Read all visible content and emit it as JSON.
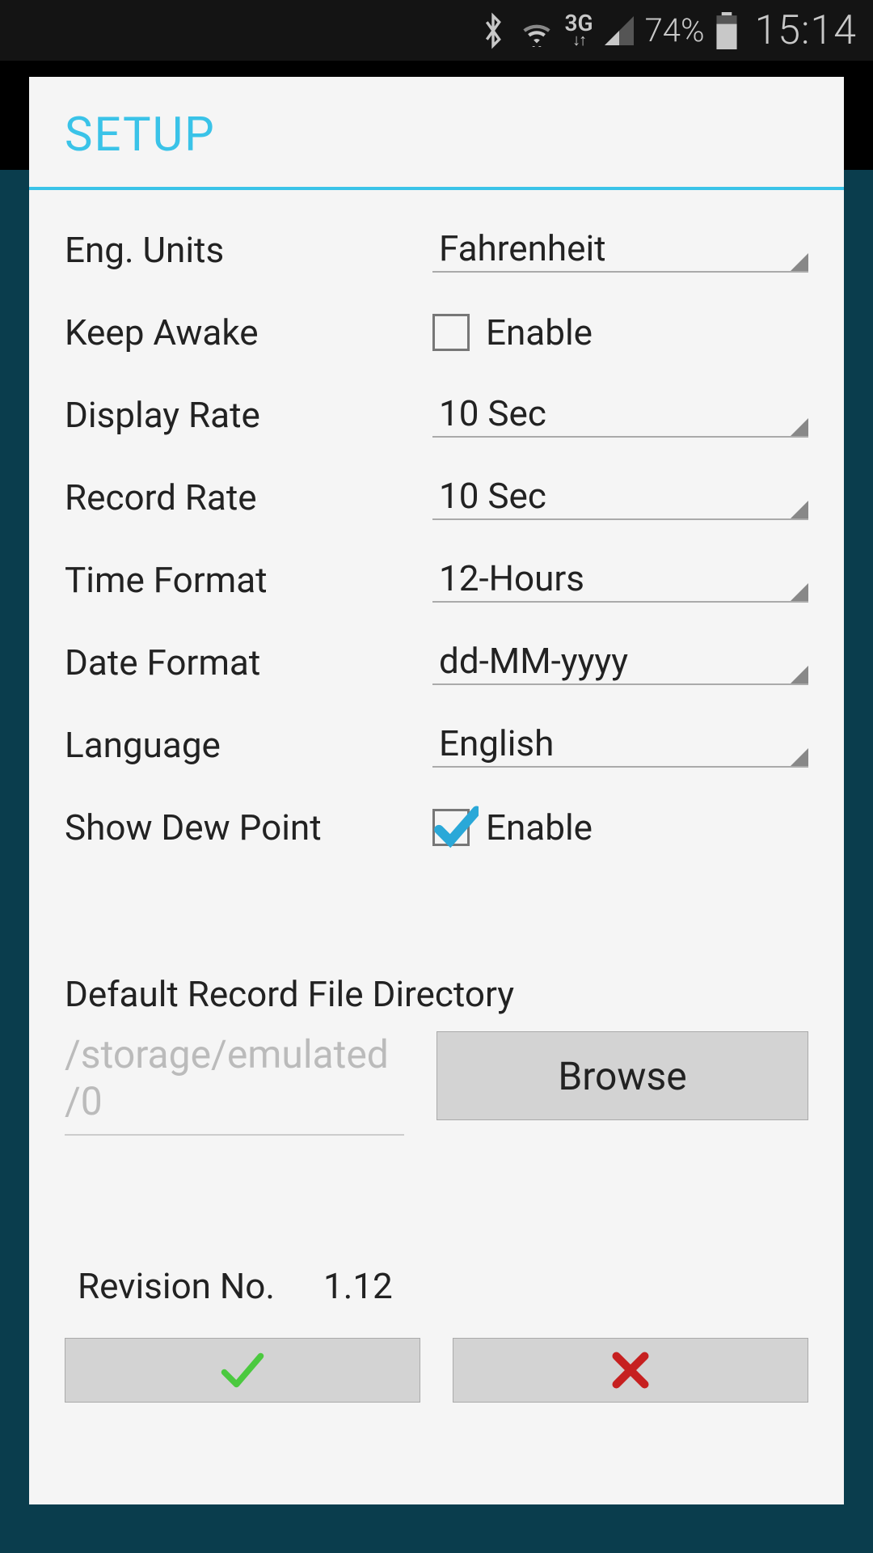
{
  "statusbar": {
    "network_label": "3G",
    "battery_pct": "74%",
    "time": "15:14"
  },
  "dialog": {
    "title": "SETUP",
    "settings": {
      "eng_units": {
        "label": "Eng. Units",
        "value": "Fahrenheit"
      },
      "keep_awake": {
        "label": "Keep Awake",
        "checkbox_label": "Enable",
        "checked": false
      },
      "display_rate": {
        "label": "Display Rate",
        "value": "10 Sec"
      },
      "record_rate": {
        "label": "Record Rate",
        "value": "10 Sec"
      },
      "time_format": {
        "label": "Time Format",
        "value": "12-Hours"
      },
      "date_format": {
        "label": "Date Format",
        "value": "dd-MM-yyyy"
      },
      "language": {
        "label": "Language",
        "value": "English"
      },
      "show_dew_point": {
        "label": "Show Dew Point",
        "checkbox_label": "Enable",
        "checked": true
      }
    },
    "directory": {
      "section_label": "Default Record File Directory",
      "path": "/storage/emulated/0",
      "browse_label": "Browse"
    },
    "revision": {
      "label": "Revision No.",
      "value": "1.12"
    }
  }
}
